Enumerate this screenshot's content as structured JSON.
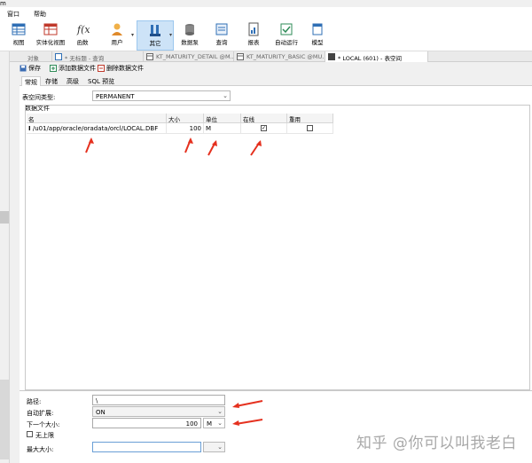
{
  "top_fragment": "m",
  "menu": {
    "items": [
      "窗口",
      "帮助"
    ]
  },
  "toolbar": {
    "buttons": [
      {
        "label": "视图",
        "icon": "table-icon"
      },
      {
        "label": "实体化视图",
        "icon": "materialized-view-icon"
      },
      {
        "label": "函数",
        "icon": "function-icon"
      },
      {
        "label": "用户",
        "icon": "user-icon"
      },
      {
        "label": "其它",
        "icon": "tools-icon"
      },
      {
        "label": "数据泵",
        "icon": "data-pump-icon"
      },
      {
        "label": "查询",
        "icon": "query-icon"
      },
      {
        "label": "报表",
        "icon": "report-icon"
      },
      {
        "label": "自动运行",
        "icon": "automation-icon"
      },
      {
        "label": "模型",
        "icon": "model-icon"
      }
    ]
  },
  "doc_tabs": [
    {
      "label": "对象"
    },
    {
      "label": "* 无标题 - 查询"
    },
    {
      "label": "KT_MATURITY_DETAIL @M..."
    },
    {
      "label": "KT_MATURITY_BASIC @MU..."
    },
    {
      "label": "* LOCAL (601) - 表空间"
    }
  ],
  "actions": {
    "save": "保存",
    "add_file": "添加数据文件",
    "delete_file": "删除数据文件"
  },
  "subtabs": [
    "常规",
    "存储",
    "高级",
    "SQL 预览"
  ],
  "form": {
    "tablespace_type_label": "表空间类型:",
    "tablespace_type_value": "PERMANENT",
    "datafile_group_label": "数据文件",
    "path_label": "路径:",
    "path_value": "\\",
    "autoextend_label": "自动扩展:",
    "autoextend_value": "ON",
    "next_size_label": "下一个大小:",
    "next_size_value": "100",
    "next_size_unit": "M",
    "unlimited_label": "无上限",
    "max_size_label": "最大大小:"
  },
  "grid": {
    "headers": [
      "名",
      "大小",
      "单位",
      "在线",
      "重用"
    ],
    "rows": [
      {
        "name": "/u01/app/oracle/oradata/orcl/LOCAL.DBF",
        "size": "100",
        "unit": "M",
        "online": true,
        "reuse": false
      }
    ]
  },
  "watermark": "知乎 @你可以叫我老白",
  "colors": {
    "annotation_arrow": "#e5311f",
    "active_tab": "#cde3f7"
  }
}
